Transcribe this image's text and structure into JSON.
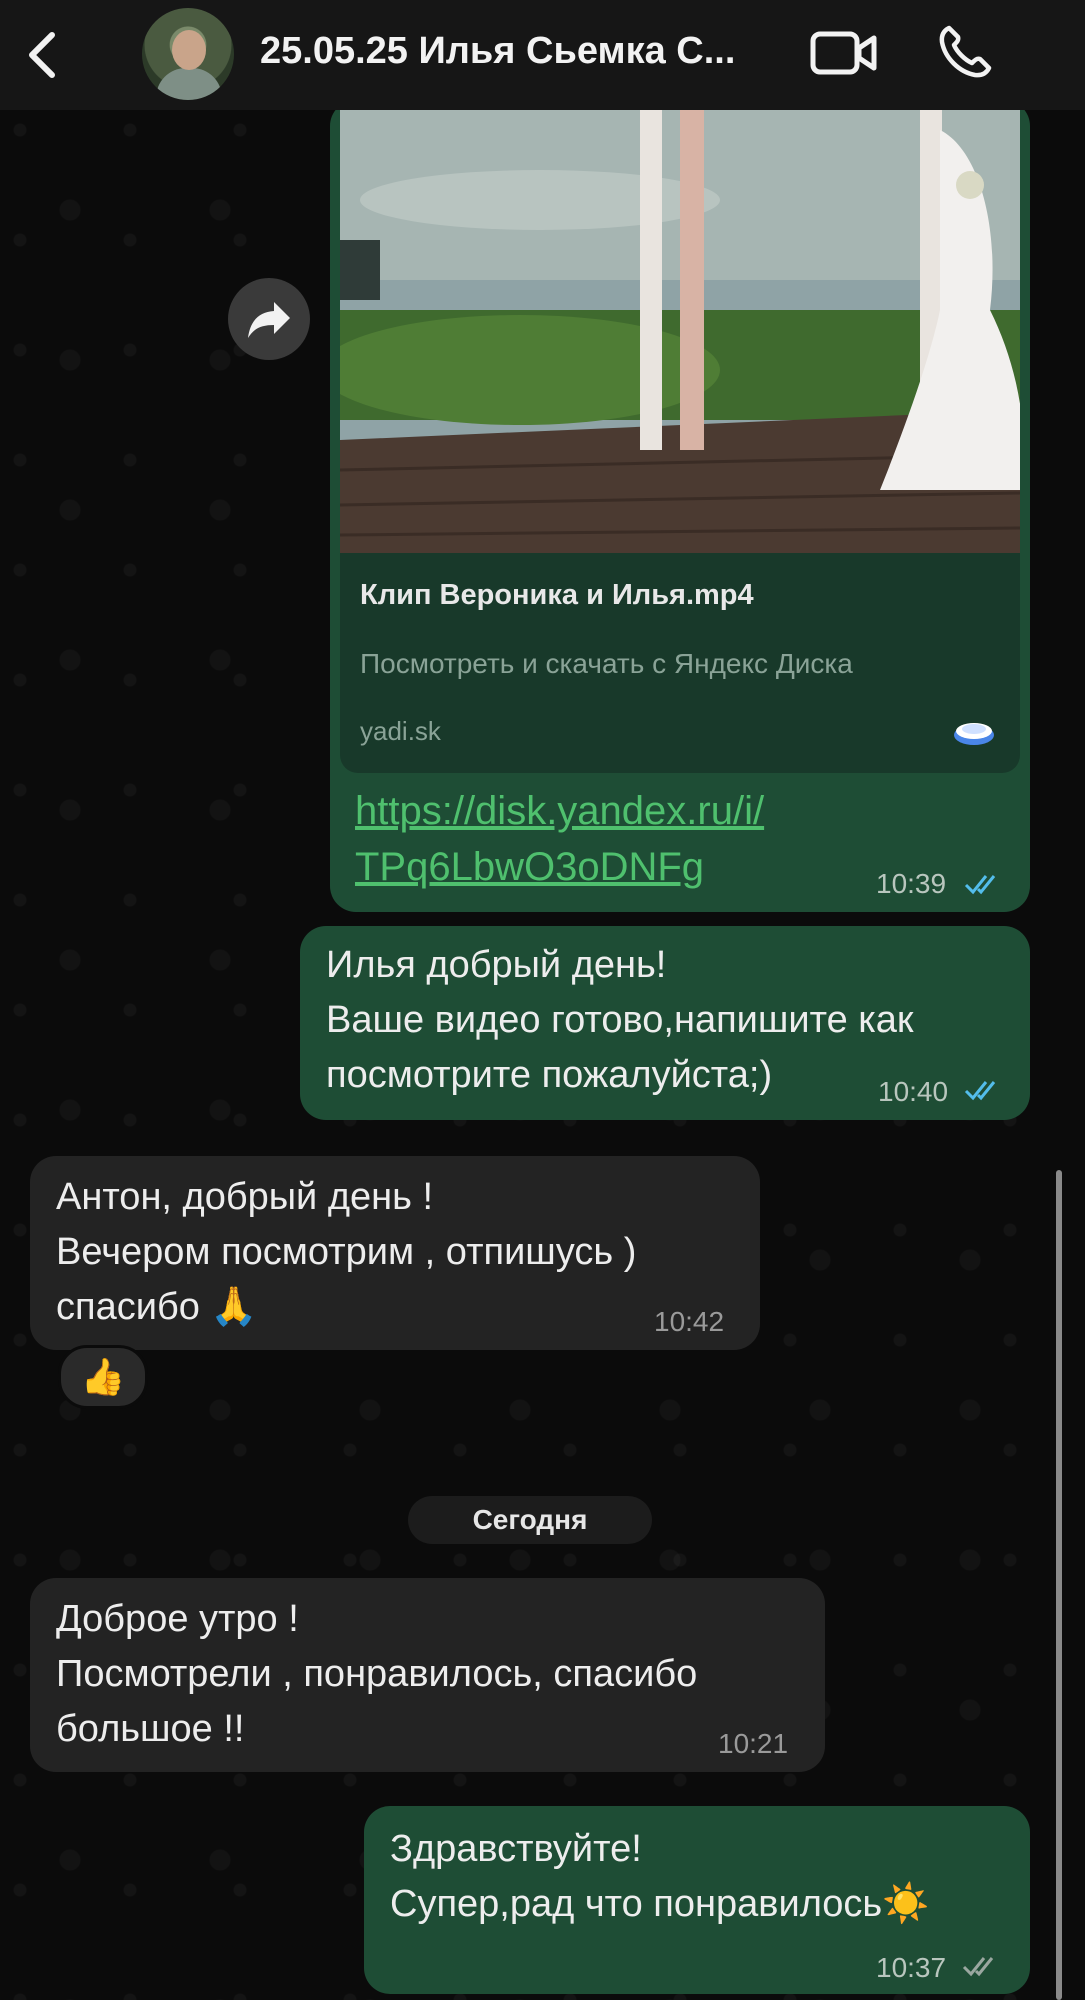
{
  "header": {
    "title": "25.05.25 Илья Сьемка С...",
    "back_icon": "chevron-left-icon",
    "video_icon": "video-call-icon",
    "call_icon": "phone-icon"
  },
  "link_message": {
    "preview_title": "Клип Вероника и Илья.mp4",
    "preview_subtitle": "Посмотреть и скачать с Яндекс Диска",
    "preview_domain": "yadi.sk",
    "link": "https://disk.yandex.ru/i/\nTPq6LbwO3oDNFg",
    "time": "10:39"
  },
  "messages": [
    {
      "direction": "out",
      "text": "Илья добрый день!\nВаше видео готово,напишите как\nпосмотрите пожалуйста;)",
      "time": "10:40"
    },
    {
      "direction": "in",
      "text": "Антон, добрый день !\nВечером посмотрим , отпишусь )\nспасибо 🙏",
      "time": "10:42",
      "reaction": "👍"
    },
    {
      "direction": "in",
      "text": "Доброе утро !\nПосмотрели , понравилось, спасибо\nбольшое !!",
      "time": "10:21"
    },
    {
      "direction": "out",
      "text": "Здравствуйте!\nСупер,рад что понравилось☀️",
      "time": "10:37"
    }
  ],
  "date_separator": "Сегодня",
  "colors": {
    "outgoing_bubble": "#1e4d35",
    "incoming_bubble": "#232323",
    "link": "#4fc06e",
    "read_ticks": "#53bdeb"
  }
}
